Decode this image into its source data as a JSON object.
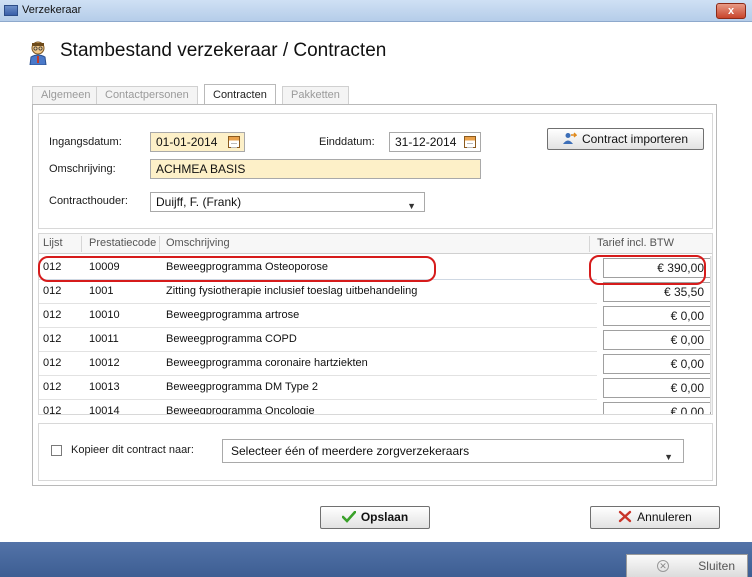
{
  "window": {
    "title": "Verzekeraar",
    "close_glyph": "x",
    "icon": "app-window-icon"
  },
  "header": {
    "title": "Stambestand verzekeraar / Contracten",
    "icon": "user-avatar-icon"
  },
  "tabs": [
    {
      "label": "Algemeen",
      "active": false
    },
    {
      "label": "Contactpersonen",
      "active": false
    },
    {
      "label": "Contracten",
      "active": true
    },
    {
      "label": "Pakketten",
      "active": false
    }
  ],
  "form": {
    "ingangsdatum_label": "Ingangsdatum:",
    "ingangsdatum_value": "01-01-2014",
    "einddatum_label": "Einddatum:",
    "einddatum_value": "31-12-2014",
    "omschrijving_label": "Omschrijving:",
    "omschrijving_value": "ACHMEA BASIS",
    "contracthouder_label": "Contracthouder:",
    "contracthouder_value": "Duijff, F. (Frank)",
    "import_button": "Contract importeren"
  },
  "table": {
    "columns": [
      "Lijst",
      "Prestatiecode",
      "Omschrijving",
      "Tarief incl. BTW"
    ],
    "rows": [
      {
        "lijst": "012",
        "code": "10009",
        "omschrijving": "Beweegprogramma Osteoporose",
        "tarief": "€ 390,00"
      },
      {
        "lijst": "012",
        "code": "1001",
        "omschrijving": "Zitting fysiotherapie inclusief toeslag uitbehandeling",
        "tarief": "€ 35,50"
      },
      {
        "lijst": "012",
        "code": "10010",
        "omschrijving": "Beweegprogramma artrose",
        "tarief": "€ 0,00"
      },
      {
        "lijst": "012",
        "code": "10011",
        "omschrijving": "Beweegprogramma COPD",
        "tarief": "€ 0,00"
      },
      {
        "lijst": "012",
        "code": "10012",
        "omschrijving": "Beweegprogramma coronaire hartziekten",
        "tarief": "€ 0,00"
      },
      {
        "lijst": "012",
        "code": "10013",
        "omschrijving": "Beweegprogramma DM Type 2",
        "tarief": "€ 0,00"
      },
      {
        "lijst": "012",
        "code": "10014",
        "omschrijving": "Beweegprogramma Oncologie",
        "tarief": "€ 0,00"
      }
    ]
  },
  "copy": {
    "checkbox_label": "Kopieer dit contract naar:",
    "select_value": "Selecteer één of meerdere zorgverzekeraars"
  },
  "buttons": {
    "save": "Opslaan",
    "cancel": "Annuleren",
    "close": "Sluiten"
  },
  "colors": {
    "field_bg": "#fdf0c8",
    "highlight": "#d61b1b",
    "statusbar": "#4a6a9f"
  }
}
